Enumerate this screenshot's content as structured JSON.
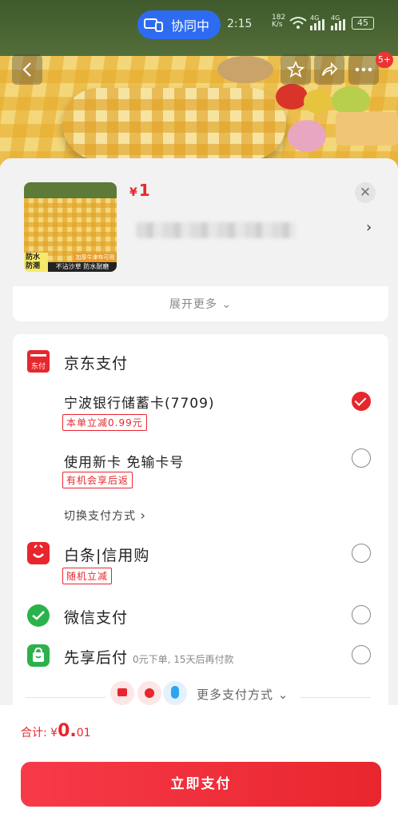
{
  "status_bar": {
    "collab_label": "协同中",
    "time": "2:15",
    "net_speed": "182\nK/s",
    "signal_1": "4G",
    "signal_2": "4G",
    "battery": "45"
  },
  "nav": {
    "badge": "5+"
  },
  "product": {
    "price_symbol": "¥",
    "price": "1",
    "image_tag_1": "防水\n防潮",
    "image_tag_2": "不沾沙草 防水耐磨",
    "image_tag_3": "加厚牛津布可用"
  },
  "expand_more": "展开更多",
  "jd_pay": {
    "title": "京东支付",
    "logo_text": "东付",
    "options": [
      {
        "label": "宁波银行储蓄卡(7709)",
        "tag": "本单立减0.99元",
        "selected": true
      },
      {
        "label": "使用新卡 免输卡号",
        "tag": "有机会享后返",
        "selected": false
      }
    ],
    "switch_label": "切换支付方式"
  },
  "baitiao": {
    "label": "白条|信用购",
    "tag": "随机立减"
  },
  "wechat": {
    "label": "微信支付"
  },
  "xianxiang": {
    "label": "先享后付",
    "note": "0元下单, 15天后再付款"
  },
  "more_methods": "更多支付方式",
  "footer": {
    "total_label": "合计:",
    "currency": "¥",
    "amount_int": "0.",
    "amount_dec": "01",
    "pay_button": "立即支付"
  },
  "colors": {
    "accent": "#e8262d",
    "collab_blue": "#2d6cf2",
    "wechat_green": "#2bb24c"
  }
}
